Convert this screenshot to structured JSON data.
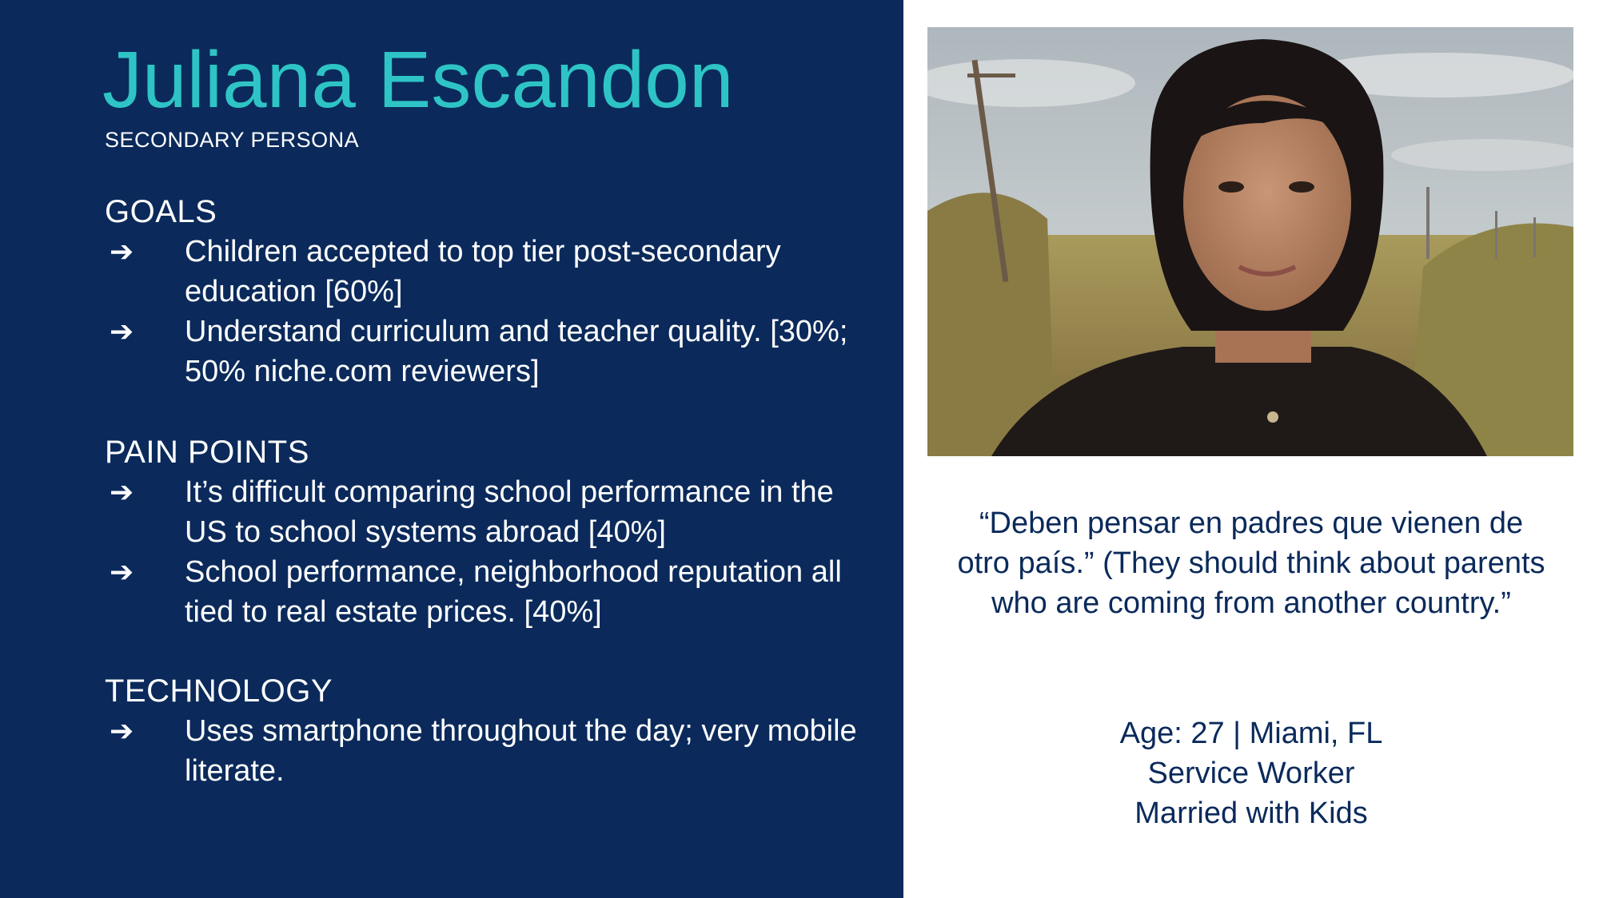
{
  "persona": {
    "name": "Juliana Escandon",
    "role": "SECONDARY PERSONA"
  },
  "sections": {
    "goals": {
      "heading": "GOALS",
      "items": [
        "Children accepted to top tier post-secondary education [60%]",
        "Understand curriculum and teacher quality. [30%; 50% niche.com reviewers]"
      ]
    },
    "pain_points": {
      "heading": "PAIN POINTS",
      "items": [
        "It’s difficult comparing school performance in the US to school systems abroad [40%]",
        "School performance, neighborhood reputation all tied to real estate prices. [40%]"
      ]
    },
    "technology": {
      "heading": "TECHNOLOGY",
      "items": [
        "Uses smartphone throughout the day; very mobile literate."
      ]
    }
  },
  "bullet_icon": "arrow-right-icon",
  "quote": "“Deben pensar en padres que vienen de otro país.” (They should think about parents who are coming from another country.”",
  "facts": {
    "age_location": "Age: 27 | Miami, FL",
    "occupation": "Service Worker",
    "family": "Married with Kids"
  },
  "colors": {
    "panel_bg": "#0b2a5b",
    "accent_teal": "#2ec4c6",
    "text_navy": "#0b2a5b"
  }
}
